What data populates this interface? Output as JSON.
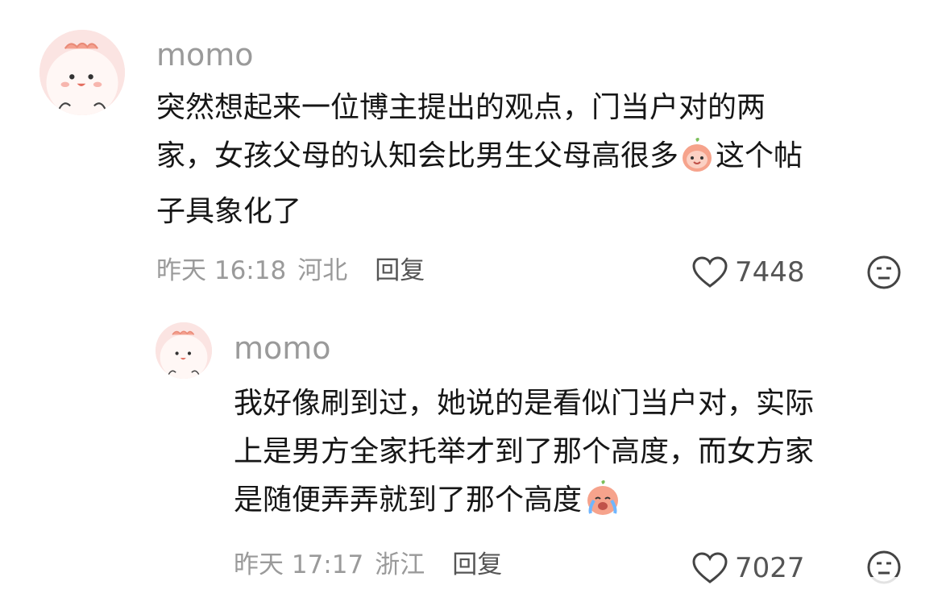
{
  "comments": [
    {
      "username": "momo",
      "text_lines": [
        "突然想起来一位博主提出的观点，门当户对的两",
        "家，女孩父母的认知会比男生父母高很多",
        "这个帖",
        "子具象化了"
      ],
      "time": "昨天 16:18",
      "location": "河北",
      "reply_label": "回复",
      "likes": "7448",
      "emoji": "peach-smile-emoji"
    },
    {
      "username": "momo",
      "text_lines": [
        "我好像刷到过，她说的是看似门当户对，实际",
        "上是男方全家托举才到了那个高度，而女方家",
        "是随便弄弄就到了那个高度"
      ],
      "time": "昨天 17:17",
      "location": "浙江",
      "reply_label": "回复",
      "likes": "7027",
      "emoji": "peach-crying-emoji"
    }
  ],
  "colors": {
    "muted": "#9a9a9a",
    "text": "#161616",
    "avatar_bg": "#fbe4e2",
    "peach": "#f6a38c"
  }
}
